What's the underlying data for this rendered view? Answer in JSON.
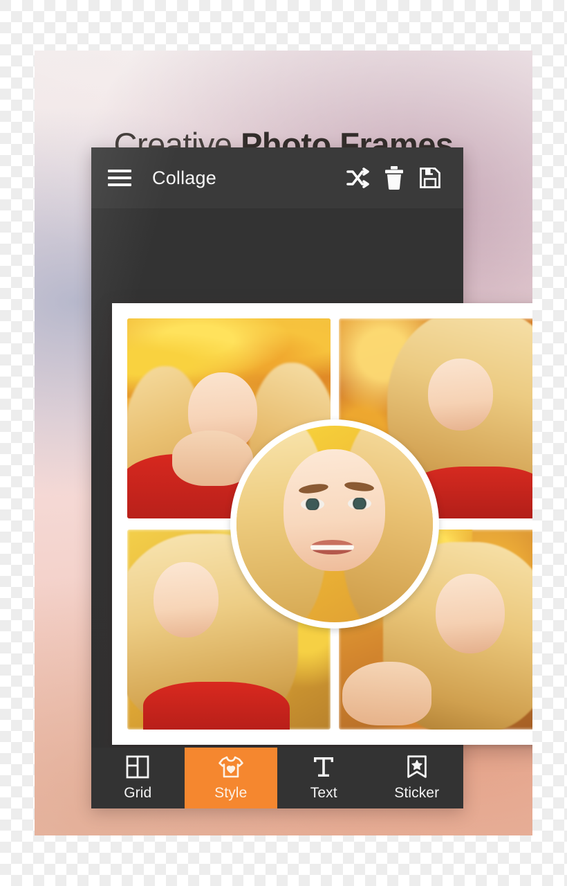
{
  "promo": {
    "headline_light": "Creative ",
    "headline_bold": "Photo Frames",
    "accent_color": "#f5872f",
    "appbar_color": "#3a3a3a",
    "body_color": "#333333"
  },
  "appbar": {
    "menu_icon": "hamburger-menu-icon",
    "title": "Collage",
    "actions": [
      {
        "name": "shuffle",
        "icon": "shuffle-icon"
      },
      {
        "name": "delete",
        "icon": "trash-icon"
      },
      {
        "name": "save",
        "icon": "floppy-save-icon"
      }
    ]
  },
  "collage": {
    "layout": "2x2-grid-with-center-circle",
    "tiles": [
      {
        "position": "top-left",
        "subject": "woman-with-autumn-leaf-wreath-red-sweater"
      },
      {
        "position": "top-right",
        "subject": "blonde-woman-portrait-autumn-bokeh"
      },
      {
        "position": "bottom-left",
        "subject": "smiling-blonde-woman-yellow-bokeh"
      },
      {
        "position": "bottom-right",
        "subject": "woman-with-leaf-wreath-smiling"
      },
      {
        "position": "center-circle",
        "subject": "close-up-smiling-blonde-woman"
      }
    ]
  },
  "nav": {
    "items": [
      {
        "label": "Grid",
        "icon": "grid-layout-icon",
        "active": false
      },
      {
        "label": "Style",
        "icon": "tshirt-heart-icon",
        "active": true
      },
      {
        "label": "Text",
        "icon": "text-t-icon",
        "active": false
      },
      {
        "label": "Sticker",
        "icon": "bookmark-star-icon",
        "active": false
      }
    ]
  }
}
